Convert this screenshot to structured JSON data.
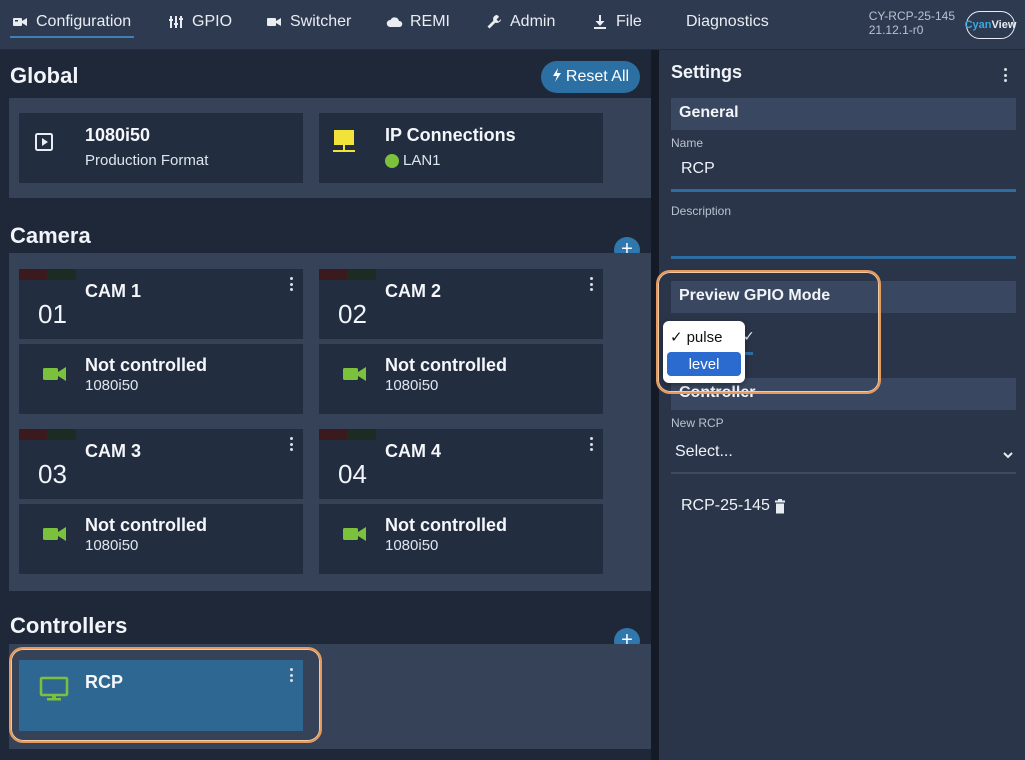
{
  "nav": {
    "items": [
      {
        "label": "Configuration",
        "icon": "camera-icon"
      },
      {
        "label": "GPIO",
        "icon": "gpio-icon"
      },
      {
        "label": "Switcher",
        "icon": "switcher-icon"
      },
      {
        "label": "REMI",
        "icon": "cloud-icon"
      },
      {
        "label": "Admin",
        "icon": "wrench-icon"
      },
      {
        "label": "File",
        "icon": "download-icon"
      },
      {
        "label": "Diagnostics",
        "icon": ""
      }
    ],
    "device_name": "CY-RCP-25-145",
    "device_version": "21.12.1-r0",
    "logo_prefix": "Cyan",
    "logo_suffix": "View"
  },
  "global": {
    "title": "Global",
    "reset_label": "Reset All",
    "format_title": "1080i50",
    "format_sub": "Production Format",
    "ip_title": "IP Connections",
    "ip_sub": "LAN1"
  },
  "camera": {
    "title": "Camera",
    "cams": [
      {
        "num": "01",
        "name": "CAM 1",
        "status": "Not controlled",
        "format": "1080i50"
      },
      {
        "num": "02",
        "name": "CAM 2",
        "status": "Not controlled",
        "format": "1080i50"
      },
      {
        "num": "03",
        "name": "CAM 3",
        "status": "Not controlled",
        "format": "1080i50"
      },
      {
        "num": "04",
        "name": "CAM 4",
        "status": "Not controlled",
        "format": "1080i50"
      }
    ]
  },
  "controllers": {
    "title": "Controllers",
    "item_label": "RCP"
  },
  "settings": {
    "title": "Settings",
    "general_header": "General",
    "name_label": "Name",
    "name_value": "RCP",
    "description_label": "Description",
    "description_value": "",
    "preview_header": "Preview GPIO Mode",
    "controller_header": "Controller",
    "new_rcp_label": "New RCP",
    "new_rcp_value": "Select...",
    "rcp_entry": "RCP-25-145",
    "dropdown_options": [
      "pulse",
      "level"
    ],
    "dropdown_checked": "pulse"
  },
  "colors": {
    "accent": "#2f77ad",
    "ok_green": "#7cc13c",
    "warn_yellow": "#f2e33a",
    "highlight": "#e59b5e"
  }
}
